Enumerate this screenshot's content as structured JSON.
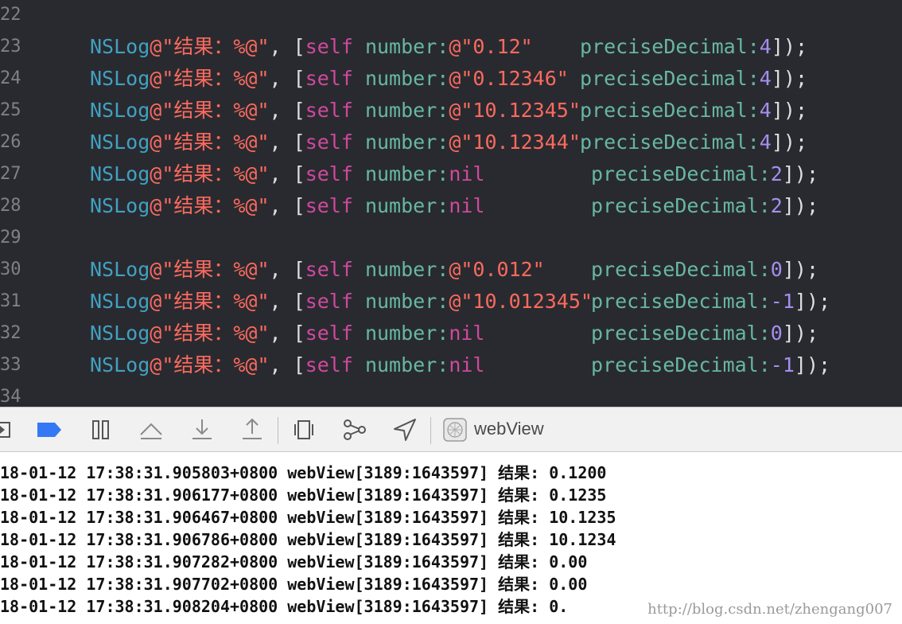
{
  "editor": {
    "lines": [
      {
        "num": "22",
        "code": null
      },
      {
        "num": "23",
        "code": {
          "prefix": "NSLog",
          "fmt": "@\"结果：%@\"",
          "sep": ", [",
          "self": "self",
          "method": " number:",
          "arg": "@\"0.12\"",
          "argType": "str",
          "pd": "preciseDecimal:",
          "pdNum": "4",
          "close": "]);"
        }
      },
      {
        "num": "24",
        "code": {
          "prefix": "NSLog",
          "fmt": "@\"结果：%@\"",
          "sep": ", [",
          "self": "self",
          "method": " number:",
          "arg": "@\"0.12346\"",
          "argType": "str",
          "pd": "preciseDecimal:",
          "pdNum": "4",
          "close": "]);"
        }
      },
      {
        "num": "25",
        "code": {
          "prefix": "NSLog",
          "fmt": "@\"结果：%@\"",
          "sep": ", [",
          "self": "self",
          "method": " number:",
          "arg": "@\"10.12345\"",
          "argType": "str",
          "pd": "preciseDecimal:",
          "pdNum": "4",
          "close": "]);"
        }
      },
      {
        "num": "26",
        "code": {
          "prefix": "NSLog",
          "fmt": "@\"结果：%@\"",
          "sep": ", [",
          "self": "self",
          "method": " number:",
          "arg": "@\"10.12344\"",
          "argType": "str",
          "pd": "preciseDecimal:",
          "pdNum": "4",
          "close": "]);"
        }
      },
      {
        "num": "27",
        "code": {
          "prefix": "NSLog",
          "fmt": "@\"结果：%@\"",
          "sep": ", [",
          "self": "self",
          "method": " number:",
          "arg": "nil",
          "argType": "kw",
          "pd": "preciseDecimal:",
          "pdNum": "2",
          "close": "]);"
        }
      },
      {
        "num": "28",
        "code": {
          "prefix": "NSLog",
          "fmt": "@\"结果：%@\"",
          "sep": ", [",
          "self": "self",
          "method": " number:",
          "arg": "nil",
          "argType": "kw",
          "pd": "preciseDecimal:",
          "pdNum": "2",
          "close": "]);"
        }
      },
      {
        "num": "29",
        "code": null
      },
      {
        "num": "30",
        "code": {
          "prefix": "NSLog",
          "fmt": "@\"结果：%@\"",
          "sep": ", [",
          "self": "self",
          "method": " number:",
          "arg": "@\"0.012\"",
          "argType": "str",
          "pd": "preciseDecimal:",
          "pdNum": "0",
          "close": "]);"
        }
      },
      {
        "num": "31",
        "code": {
          "prefix": "NSLog",
          "fmt": "@\"结果：%@\"",
          "sep": ", [",
          "self": "self",
          "method": " number:",
          "arg": "@\"10.012345\"",
          "argType": "str",
          "pd": "preciseDecimal:",
          "pdNum": "-1",
          "close": "]);"
        }
      },
      {
        "num": "32",
        "code": {
          "prefix": "NSLog",
          "fmt": "@\"结果：%@\"",
          "sep": ", [",
          "self": "self",
          "method": " number:",
          "arg": "nil",
          "argType": "kw",
          "pd": "preciseDecimal:",
          "pdNum": "0",
          "close": "]);"
        }
      },
      {
        "num": "33",
        "code": {
          "prefix": "NSLog",
          "fmt": "@\"结果：%@\"",
          "sep": ", [",
          "self": "self",
          "method": " number:",
          "arg": "nil",
          "argType": "kw",
          "pd": "preciseDecimal:",
          "pdNum": "-1",
          "close": "]);"
        }
      },
      {
        "num": "34",
        "code": null
      }
    ]
  },
  "toolbar": {
    "label": "webView",
    "icons": [
      "hide-debug-area-icon",
      "breakpoint-icon",
      "pause-icon",
      "step-over-icon",
      "step-into-icon",
      "step-out-icon",
      "view-hierarchy-icon",
      "memory-graph-icon",
      "location-icon",
      "target-app-icon"
    ]
  },
  "console": {
    "lines": [
      "18-01-12 17:38:31.905803+0800 webView[3189:1643597] 结果: 0.1200",
      "18-01-12 17:38:31.906177+0800 webView[3189:1643597] 结果: 0.1235",
      "18-01-12 17:38:31.906467+0800 webView[3189:1643597] 结果: 10.1235",
      "18-01-12 17:38:31.906786+0800 webView[3189:1643597] 结果: 10.1234",
      "18-01-12 17:38:31.907282+0800 webView[3189:1643597] 结果: 0.00",
      "18-01-12 17:38:31.907702+0800 webView[3189:1643597] 结果: 0.00",
      "18-01-12 17:38:31.908204+0800 webView[3189:1643597] 结果: 0."
    ],
    "watermark": "http://blog.csdn.net/zhengang007"
  },
  "colors": {
    "editor_bg": "#292a30",
    "function": "#41a1c0",
    "string": "#fc6a5d",
    "keyword": "#d0499b",
    "method": "#67b7a4",
    "number": "#a68eee",
    "breakpoint": "#3478f6"
  }
}
